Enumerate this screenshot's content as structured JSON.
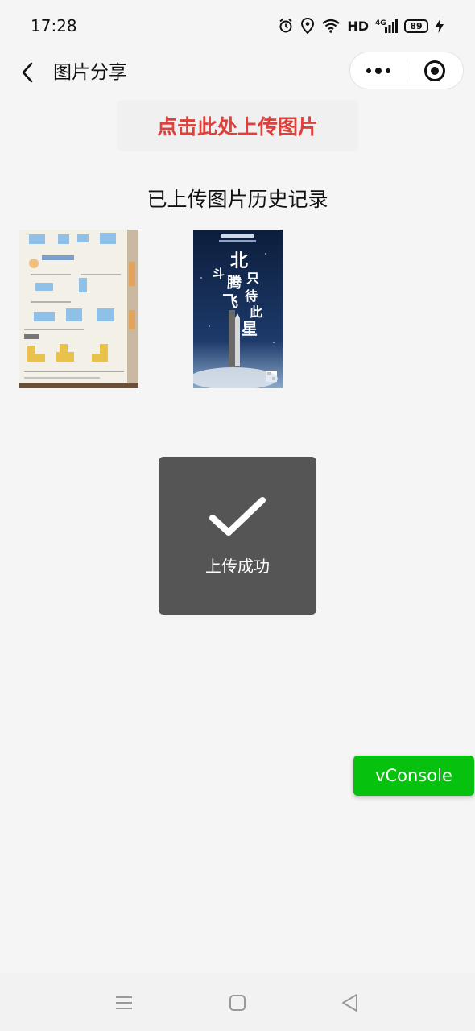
{
  "status_bar": {
    "time": "17:28",
    "network": "HD",
    "signal": "4G",
    "battery": "89",
    "icons": [
      "alarm-icon",
      "location-icon",
      "wifi-icon",
      "signal-icon",
      "battery-icon",
      "charging-icon"
    ]
  },
  "nav": {
    "title": "图片分享",
    "back_icon": "chevron-left-icon",
    "more_icon": "more-dots-icon",
    "close_icon": "target-icon"
  },
  "upload_button": {
    "label": "点击此处上传图片",
    "color": "#e0403b"
  },
  "history": {
    "title": "已上传图片历史记录",
    "images": [
      {
        "name": "worksheet-photo"
      },
      {
        "name": "poster-photo",
        "poster_lines": [
          "北",
          "斗",
          "腾",
          "只",
          "飞",
          "待",
          "此",
          "星"
        ]
      }
    ]
  },
  "toast": {
    "text": "上传成功",
    "icon": "checkmark-icon"
  },
  "vconsole": {
    "label": "vConsole",
    "color": "#07c10f"
  },
  "system_nav": {
    "icons": [
      "menu-icon",
      "home-square-icon",
      "back-triangle-icon"
    ]
  }
}
